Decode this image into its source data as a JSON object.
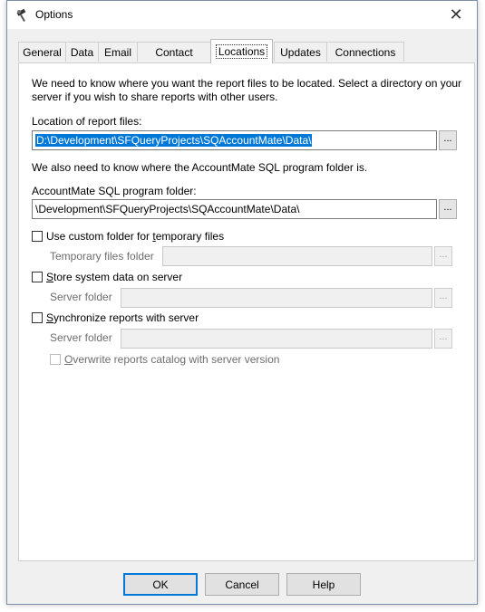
{
  "window": {
    "title": "Options",
    "close_label": "✕"
  },
  "tabs": [
    {
      "label": "General"
    },
    {
      "label": "Data"
    },
    {
      "label": "Email"
    },
    {
      "label": "Contact"
    },
    {
      "label": "Locations"
    },
    {
      "label": "Updates"
    },
    {
      "label": "Connections"
    }
  ],
  "active_tab": "Locations",
  "locations": {
    "intro": "We need to know where you want the report files to be located. Select a directory on your server if you wish to share reports with other users.",
    "report_files_label": "Location of report files:",
    "report_files_value": "D:\\Development\\SFQueryProjects\\SQAccountMate\\Data\\",
    "browse_label": "...",
    "program_intro": "We also need to know where the AccountMate SQL program folder is.",
    "program_folder_label": "AccountMate SQL program folder:",
    "program_folder_value": "\\Development\\SFQueryProjects\\SQAccountMate\\Data\\",
    "custom_temp": {
      "label_pre": "Use custom folder for ",
      "label_ul": "t",
      "label_post": "emporary files",
      "checked": false
    },
    "temp_folder_label": "Temporary files folder",
    "store_system": {
      "label_ul": "S",
      "label_post": "tore system data on server",
      "checked": false
    },
    "server_folder_label": "Server folder",
    "sync_reports": {
      "label_ul": "S",
      "label_post": "ynchronize reports with server",
      "checked": false
    },
    "server_folder_label_2": "Server folder",
    "overwrite": {
      "label_ul": "O",
      "label_post": "verwrite reports catalog with server version",
      "checked": false
    }
  },
  "buttons": {
    "ok": "OK",
    "cancel": "Cancel",
    "help": "Help"
  },
  "colors": {
    "accent": "#0078d7",
    "window_bg": "#f0f0f0",
    "panel_bg": "#ffffff"
  }
}
